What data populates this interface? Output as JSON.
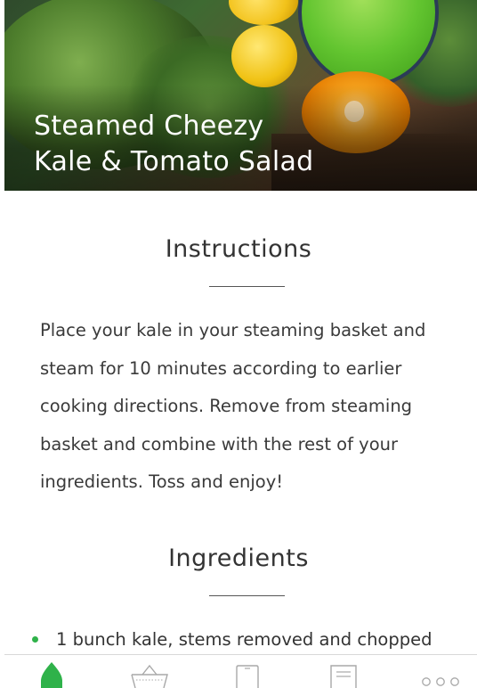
{
  "hero": {
    "title_line1": "Steamed Cheezy",
    "title_line2": "Kale & Tomato Salad"
  },
  "instructions": {
    "heading": "Instructions",
    "text": "Place your kale in your steaming basket and steam for 10 minutes according to earlier cooking directions. Remove from steaming basket and combine with the rest of your ingredients. Toss and enjoy!"
  },
  "ingredients": {
    "heading": "Ingredients",
    "items": [
      "1 bunch kale, stems removed and chopped"
    ]
  },
  "tabbar": {
    "tabs": [
      {
        "icon": "leaf-icon",
        "active": true
      },
      {
        "icon": "basket-icon",
        "active": false
      },
      {
        "icon": "phone-icon",
        "active": false
      },
      {
        "icon": "notes-icon",
        "active": false
      },
      {
        "icon": "more-icon",
        "active": false
      }
    ]
  },
  "colors": {
    "accent": "#2fb24a",
    "text": "#333333",
    "inactive_icon": "#a8a8a8"
  }
}
